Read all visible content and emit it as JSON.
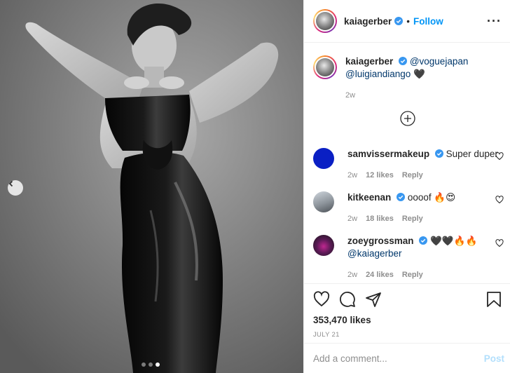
{
  "post": {
    "author": "kaiagerber",
    "follow_label": "Follow",
    "separator": "•",
    "more_label": "···",
    "caption": {
      "username": "kaiagerber",
      "mentions": "@voguejapan @luigiandiango",
      "emoji": "🖤",
      "age": "2w"
    },
    "likes_text": "353,470 likes",
    "date": "JULY 21",
    "add_comment_placeholder": "Add a comment...",
    "post_label": "Post"
  },
  "comments": [
    {
      "username": "samvissermakeup",
      "text": "Super duper",
      "age": "2w",
      "likes": "12 likes",
      "reply": "Reply"
    },
    {
      "username": "kitkeenan",
      "text": "oooof 🔥😍",
      "age": "2w",
      "likes": "18 likes",
      "reply": "Reply"
    },
    {
      "username": "zoeygrossman",
      "text": "🖤🖤🔥🔥",
      "mention": "@kaiagerber",
      "age": "2w",
      "likes": "24 likes",
      "reply": "Reply"
    }
  ],
  "carousel": {
    "slides": 3,
    "active": 3
  },
  "icons": {
    "verified": "verified-badge-icon",
    "like": "heart-icon",
    "comment": "comment-icon",
    "share": "paper-plane-icon",
    "save": "bookmark-icon",
    "load_more": "plus-circle-icon",
    "prev": "chevron-left-icon"
  },
  "colors": {
    "link": "#0095f6",
    "mention": "#00376b",
    "muted": "#8e8e8e",
    "post_disabled": "#b2dffc",
    "verified": "#3897f0"
  }
}
